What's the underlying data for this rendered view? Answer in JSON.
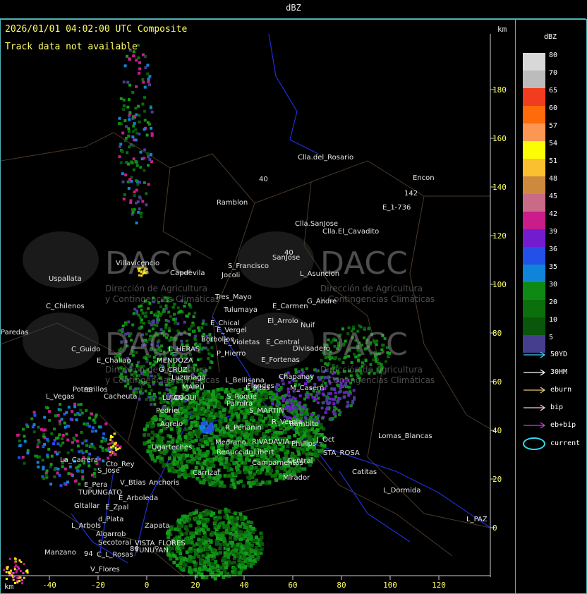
{
  "window": {
    "title": "dBZ"
  },
  "map": {
    "timestamp": "2026/01/01 04:02:00 UTC Composite",
    "track_message": "Track data not available",
    "unit_top": "km",
    "unit_bottom": "km",
    "y_ticks": [
      180,
      160,
      140,
      120,
      100,
      80,
      60,
      40,
      20,
      0
    ],
    "x_ticks": [
      -40,
      -20,
      0,
      20,
      40,
      60,
      80,
      100,
      120
    ],
    "road_labels": [
      "40",
      "142",
      "40",
      "88",
      "94",
      "86"
    ],
    "places": [
      "Clla.del_Rosario",
      "Encon",
      "Ramblon",
      "E_1-736",
      "Clla.SanJose",
      "Clla.El_Cavadito",
      "Villavicencio",
      "S_Francisco",
      "SanJose",
      "Capdevila",
      "L_Asuncion",
      "Uspallata",
      "Jocoli",
      "Tres_Mayo",
      "G_Andre",
      "C_Chilenos",
      "Tulumaya",
      "E_Carmen",
      "E_Chical",
      "El_Arrolo",
      "E_Vergel",
      "Borbollon",
      "Nuif",
      "Paredas",
      "C_Guido",
      "L_HERAS",
      "E_Violetas",
      "E_Central",
      "Divisadero",
      "E_Challao",
      "P_Hierro",
      "E_Fortenas",
      "MENDOZA",
      "G_CRUZ",
      "Luzuriaga",
      "L_Bellisana",
      "Chapanay",
      "L_Mtas",
      "MAIPU",
      "Potrerillos",
      "L_Vegas",
      "Cacheuta",
      "COQUI",
      "Flandes",
      "S_Roque",
      "M_Casern",
      "Pedriel",
      "LUJAN",
      "Palmira",
      "S_MARTIN",
      "Agrelo",
      "R_Vergia",
      "Rambito",
      "Ugarteches",
      "R_Penanin",
      "Medrano",
      "RIVADAVIA",
      "Phillips",
      "J_Oct",
      "STA_ROSA",
      "Lomas_Blancas",
      "La_Carrera",
      "Cto_Rey",
      "S_Jose",
      "Reduccion",
      "L_Libert",
      "Campamentos",
      "Catitas",
      "Carrizal",
      "Central",
      "Mirador",
      "E_Pera",
      "V_Btias",
      "Anchoris",
      "TUPUNGATO",
      "E_Arboleda",
      "L_Dormida",
      "Gltallar",
      "E_Zpal",
      "L_Arbols",
      "d_Plata",
      "Zapata",
      "L_PAZ",
      "Algarrob",
      "Secotoral",
      "VISTA_FLORES",
      "TUNUYAN",
      "Manzano",
      "C_L_Rosas",
      "V_Flores"
    ],
    "watermarks": [
      {
        "name": "DACC",
        "subtitle_1": "Dirección de Agricultura",
        "subtitle_2": "y Contingencias Climáticas"
      },
      {
        "name": "DACC",
        "subtitle_1": "Dirección de Agricultura",
        "subtitle_2": "y Contingencias Climáticas"
      },
      {
        "name": "DACC",
        "subtitle_1": "Dirección de Agricultura",
        "subtitle_2": "y Contingencias Climáticas"
      },
      {
        "name": "DACC",
        "subtitle_1": "Dirección de Agricultura",
        "subtitle_2": "y Contingencias Climáticas"
      }
    ]
  },
  "legend": {
    "title": "dBZ",
    "scale": [
      {
        "value": "80",
        "color": "#d8d8d8"
      },
      {
        "value": "70",
        "color": "#bcbcbc"
      },
      {
        "value": "65",
        "color": "#f23c1e"
      },
      {
        "value": "60",
        "color": "#ff6a0a"
      },
      {
        "value": "57",
        "color": "#fb9653"
      },
      {
        "value": "54",
        "color": "#fcfc05"
      },
      {
        "value": "51",
        "color": "#fbc02f"
      },
      {
        "value": "48",
        "color": "#ce8a3c"
      },
      {
        "value": "45",
        "color": "#c96a86"
      },
      {
        "value": "42",
        "color": "#ca1c8a"
      },
      {
        "value": "39",
        "color": "#731bcf"
      },
      {
        "value": "36",
        "color": "#2350e6"
      },
      {
        "value": "35",
        "color": "#1084d8"
      },
      {
        "value": "30",
        "color": "#0e8a14"
      },
      {
        "value": "20",
        "color": "#0b6f0b"
      },
      {
        "value": "10",
        "color": "#0a560a"
      },
      {
        "value": "5",
        "color": "#453e8f"
      }
    ],
    "tracks": [
      {
        "label": "50YD",
        "color": "#35d9ef"
      },
      {
        "label": "30HM",
        "color": "#ffffff"
      },
      {
        "label": "eburn",
        "color": "#e8c77d"
      },
      {
        "label": "bip",
        "color": "#f6c9d6"
      },
      {
        "label": "eb+bip",
        "color": "#d23dd2"
      }
    ],
    "current_label": "current"
  }
}
